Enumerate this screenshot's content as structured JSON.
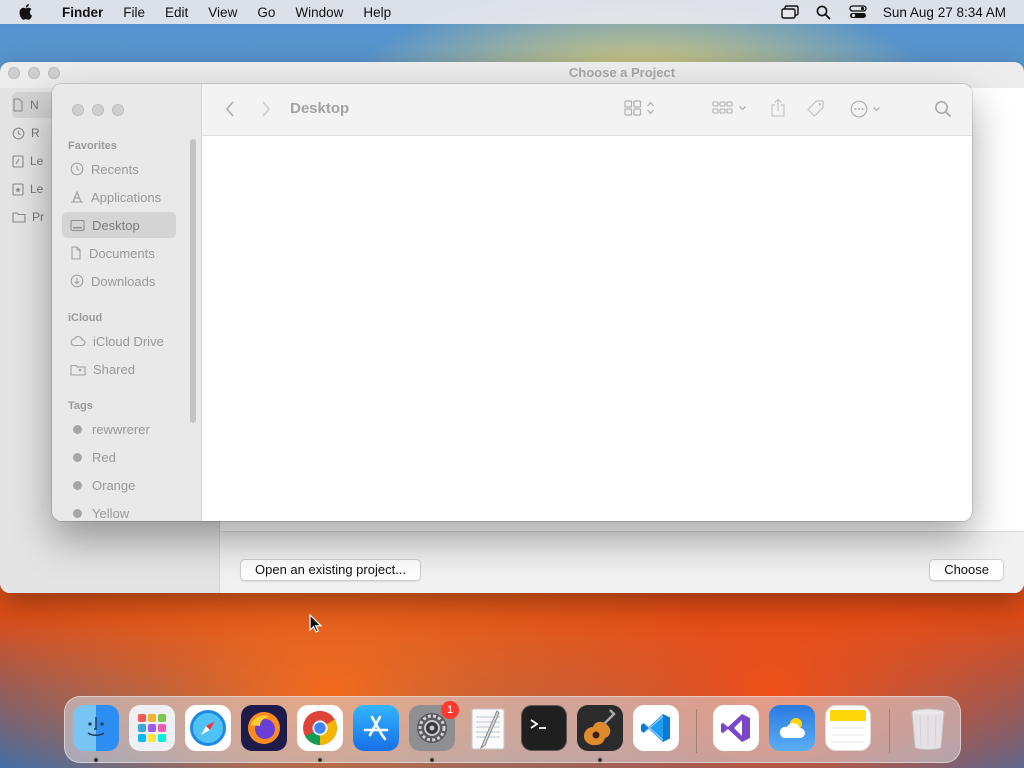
{
  "menubar": {
    "apple_icon": "apple-logo-icon",
    "items": [
      "Finder",
      "File",
      "Edit",
      "View",
      "Go",
      "Window",
      "Help"
    ],
    "status_icons": [
      "screen-mirroring-icon",
      "spotlight-search-icon",
      "control-center-icon"
    ],
    "clock": "Sun Aug 27  8:34 AM"
  },
  "dialog": {
    "title": "Choose a Project",
    "sidebar_items": [
      "N",
      "R",
      "Le",
      "Le",
      "Pr"
    ],
    "open_existing_label": "Open an existing project...",
    "choose_label": "Choose"
  },
  "finder": {
    "location_title": "Desktop",
    "sections": {
      "favorites": "Favorites",
      "icloud": "iCloud",
      "tags": "Tags"
    },
    "favorites": [
      "Recents",
      "Applications",
      "Desktop",
      "Documents",
      "Downloads"
    ],
    "icloud_items": [
      "iCloud Drive",
      "Shared"
    ],
    "tags": [
      "rewwrerer",
      "Red",
      "Orange",
      "Yellow"
    ],
    "selected_item": "Desktop"
  },
  "dock": {
    "apps": [
      {
        "name": "Finder",
        "icon": "finder-icon",
        "running": true
      },
      {
        "name": "Launchpad",
        "icon": "launchpad-icon",
        "running": false
      },
      {
        "name": "Safari",
        "icon": "safari-icon",
        "running": false
      },
      {
        "name": "Firefox",
        "icon": "firefox-icon",
        "running": false
      },
      {
        "name": "Chrome",
        "icon": "chrome-icon",
        "running": true
      },
      {
        "name": "App Store",
        "icon": "app-store-icon",
        "running": false
      },
      {
        "name": "System Settings",
        "icon": "system-settings-icon",
        "running": true,
        "badge": "1"
      },
      {
        "name": "TextEdit",
        "icon": "textedit-icon",
        "running": false
      },
      {
        "name": "Terminal",
        "icon": "terminal-icon",
        "running": false
      },
      {
        "name": "GarageBand",
        "icon": "garageband-icon",
        "running": true
      },
      {
        "name": "Visual Studio Code",
        "icon": "vscode-icon",
        "running": false
      },
      {
        "name": "Visual Studio",
        "icon": "visual-studio-icon",
        "running": false
      },
      {
        "name": "Weather",
        "icon": "weather-icon",
        "running": false
      },
      {
        "name": "Notes",
        "icon": "notes-icon",
        "running": false
      },
      {
        "name": "Trash",
        "icon": "trash-icon",
        "running": false
      }
    ],
    "badge_count": "1"
  }
}
